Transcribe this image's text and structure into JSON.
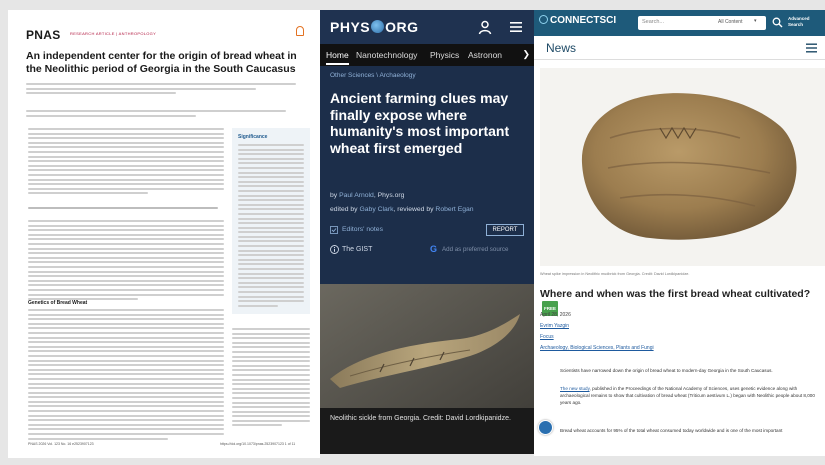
{
  "pnas": {
    "logo": "PNAS",
    "section": "RESEARCH ARTICLE | ANTHROPOLOGY",
    "title": "An independent center for the origin of bread wheat in the Neolithic period of Georgia in the South Caucasus",
    "significance_title": "Significance",
    "subhead_genetics": "Genetics of Bread Wheat",
    "footer_left": "PNAS  2026  Vol. 123  No. 16  e2523907123",
    "footer_right": "https://doi.org/10.1073/pnas.2523907123   1 of 11"
  },
  "phys": {
    "brand_left": "PHYS",
    "brand_right": "ORG",
    "nav": [
      "Home",
      "Nanotechnology",
      "Physics",
      "Astronon"
    ],
    "breadcrumb_1": "Other Sciences",
    "breadcrumb_sep": " \\ ",
    "breadcrumb_2": "Archaeology",
    "title": "Ancient farming clues may finally expose where humanity's most important wheat first emerged",
    "byline_prefix": "by ",
    "author": "Paul Arnold",
    "byline_suffix": ", Phys.org",
    "edited_prefix": "edited by ",
    "editor1": "Gaby Clark",
    "edited_mid": ", reviewed by ",
    "editor2": "Robert Egan",
    "editors_notes": "Editors' notes",
    "report": "REPORT",
    "gist": "The GIST",
    "google_label": "Add as preferred source",
    "caption": "Neolithic sickle from Georgia. Credit: David Lordkipanidze."
  },
  "csci": {
    "brand": "CONNECTSCI",
    "search_placeholder": "Search...",
    "search_scope": "All Content",
    "advanced": "Advanced Search",
    "section": "News",
    "image_caption": "Wheat spike impression in Neolithic mudbrick from Georgia. Credit: David Lordkipanidze.",
    "title": "Where and when was the first bread wheat cultivated?",
    "free_badge": "FREE",
    "date": "April 28, 2026",
    "author": "Evrim Yazgin",
    "category": "Focus",
    "tags": "Archaeology, Biological Sciences, Plants and Fungi",
    "para1": "Scientists have narrowed down the origin of bread wheat to modern-day Georgia in the South Caucasus.",
    "para2_link": "The new study",
    "para2_text": ", published in the Proceedings of the National Academy of Sciences, uses genetic evidence along with archaeological remains to show that cultivation of bread wheat (Triticum aestivum L.) began with Neolithic people about 8,000 years ago.",
    "para3": "Bread wheat accounts for 95% of the total wheat consumed today worldwide and is one of the most important"
  },
  "colors": {
    "phys_dark": "#1c2e4a",
    "phys_nav": "#111111",
    "csci_header": "#1e5a7a",
    "pnas_accent": "#b0143c"
  }
}
